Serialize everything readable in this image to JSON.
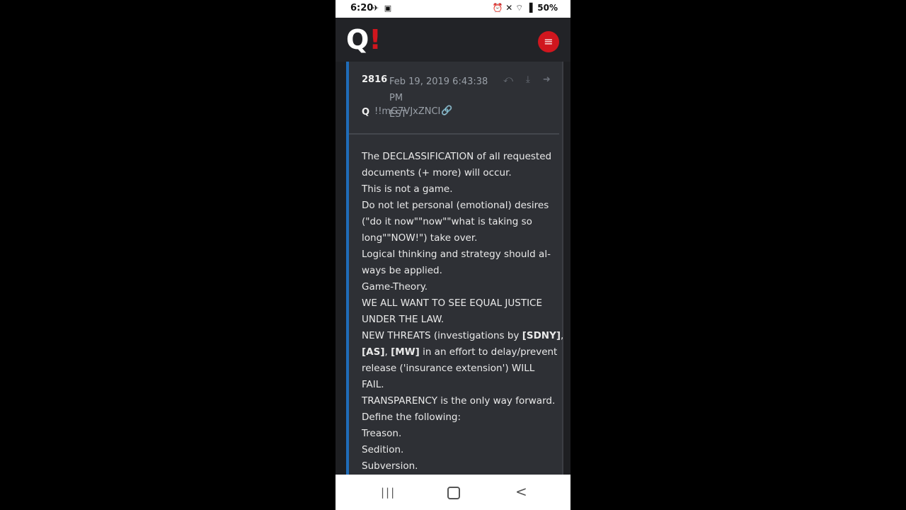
{
  "status_bar": {
    "time": "6:20",
    "left_icons": "✈ ▣",
    "right_icons": "⏰ ✕ ⌔ ▐",
    "battery": "50%"
  },
  "app": {
    "logo_q": "Q",
    "logo_bang": "!",
    "menu_icon": "≡",
    "accent_color": "#d0161e"
  },
  "post": {
    "number": "2816",
    "date_line1": "Feb 19, 2019 6:43:38 PM",
    "date_line2": "EST",
    "actions": "⤺ ⤓ ➜",
    "author": "Q",
    "tripcode": "!!mG7VJxZNCI",
    "link_icon": "🔗",
    "lines": [
      {
        "parts": [
          {
            "t": "The DECLASSIFICATION of all requested",
            "b": false
          }
        ]
      },
      {
        "parts": [
          {
            "t": "documents (+ more) will occur.",
            "b": false
          }
        ]
      },
      {
        "parts": [
          {
            "t": "This is not a game.",
            "b": false
          }
        ]
      },
      {
        "parts": [
          {
            "t": "Do not let personal (emotional) desires",
            "b": false
          }
        ]
      },
      {
        "parts": [
          {
            "t": "(\"do it now\"\"now\"\"what is taking so",
            "b": false
          }
        ]
      },
      {
        "parts": [
          {
            "t": "long\"\"NOW!\") take over.",
            "b": false
          }
        ]
      },
      {
        "parts": [
          {
            "t": "Logical thinking and strategy should al-",
            "b": false
          }
        ]
      },
      {
        "parts": [
          {
            "t": "ways be applied.",
            "b": false
          }
        ]
      },
      {
        "parts": [
          {
            "t": "Game-Theory.",
            "b": false
          }
        ]
      },
      {
        "parts": [
          {
            "t": "WE ALL WANT TO SEE EQUAL JUSTICE",
            "b": false
          }
        ]
      },
      {
        "parts": [
          {
            "t": "UNDER THE LAW.",
            "b": false
          }
        ]
      },
      {
        "parts": [
          {
            "t": "NEW THREATS (investigations by ",
            "b": false
          },
          {
            "t": "[SDNY]",
            "b": true
          },
          {
            "t": ",",
            "b": false
          }
        ]
      },
      {
        "parts": [
          {
            "t": "[AS]",
            "b": true
          },
          {
            "t": ", ",
            "b": false
          },
          {
            "t": "[MW]",
            "b": true
          },
          {
            "t": " in an effort to delay/prevent",
            "b": false
          }
        ]
      },
      {
        "parts": [
          {
            "t": "release ('insurance extension') WILL",
            "b": false
          }
        ]
      },
      {
        "parts": [
          {
            "t": "FAIL.",
            "b": false
          }
        ]
      },
      {
        "parts": [
          {
            "t": "TRANSPARENCY is the only way forward.",
            "b": false
          }
        ]
      },
      {
        "parts": [
          {
            "t": "Define the following:",
            "b": false
          }
        ]
      },
      {
        "parts": [
          {
            "t": "Treason.",
            "b": false
          }
        ]
      },
      {
        "parts": [
          {
            "t": "Sedition.",
            "b": false
          }
        ]
      },
      {
        "parts": [
          {
            "t": "Subversion.",
            "b": false
          }
        ]
      }
    ]
  },
  "nav_bar": {
    "recent_icon": "|||",
    "back_icon": "<"
  }
}
